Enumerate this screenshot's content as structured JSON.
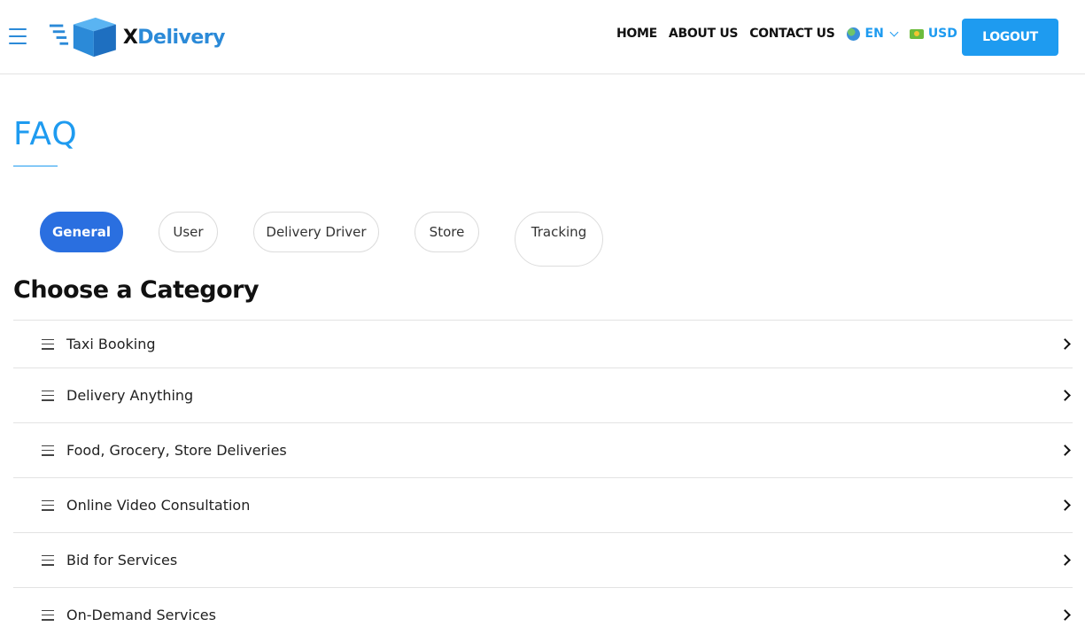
{
  "header": {
    "logo": {
      "prefix": "X",
      "suffix": "Delivery"
    },
    "nav": [
      {
        "label": "HOME"
      },
      {
        "label": "ABOUT US"
      },
      {
        "label": "CONTACT US"
      }
    ],
    "language": {
      "label": "EN",
      "icon": "globe-icon"
    },
    "currency": {
      "label": "USD",
      "icon": "money-icon"
    },
    "logout_label": "LOGOUT",
    "colors": {
      "accent": "#1e9bf0",
      "active_tab": "#2a6fe0"
    }
  },
  "page": {
    "title": "FAQ",
    "tabs": [
      {
        "label": "General",
        "active": true
      },
      {
        "label": "User",
        "active": false
      },
      {
        "label": "Delivery Driver",
        "active": false
      },
      {
        "label": "Store",
        "active": false
      },
      {
        "label": "Tracking",
        "active": false
      }
    ],
    "section_title": "Choose a Category",
    "categories": [
      {
        "label": "Taxi Booking"
      },
      {
        "label": "Delivery Anything"
      },
      {
        "label": "Food, Grocery, Store Deliveries"
      },
      {
        "label": "Online Video Consultation"
      },
      {
        "label": "Bid for Services"
      },
      {
        "label": "On-Demand Services"
      }
    ]
  }
}
